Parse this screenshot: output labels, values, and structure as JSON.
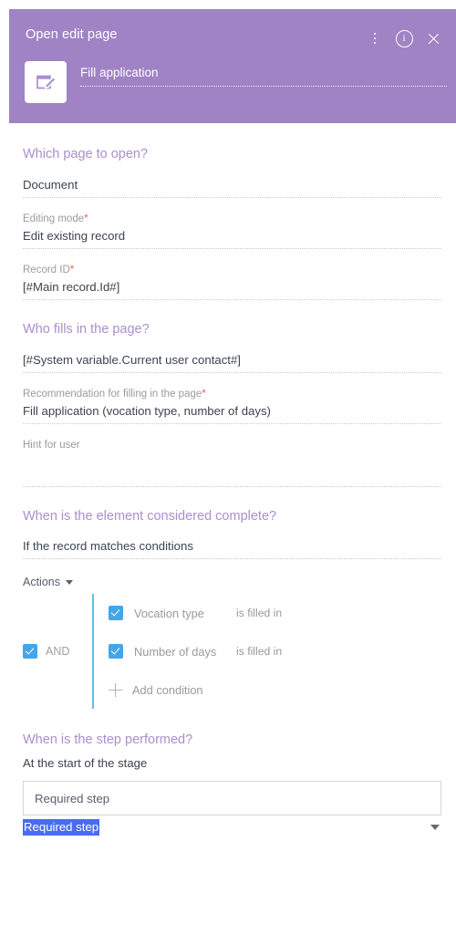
{
  "header": {
    "title": "Open edit page",
    "task_name": "Fill application",
    "icon": "edit-document-icon",
    "menu_icon": "kebab-menu-icon",
    "info_icon": "info-icon",
    "info_glyph": "i",
    "close_icon": "close-icon",
    "background_color": "#9f83c4"
  },
  "sections": {
    "which_page": {
      "heading": "Which page to open?",
      "fields": [
        {
          "label": "",
          "value": "Document",
          "required": false
        },
        {
          "label": "Editing mode",
          "value": "Edit existing record",
          "required": true
        },
        {
          "label": "Record ID",
          "value": "[#Main record.Id#]",
          "required": true
        }
      ]
    },
    "who_fills": {
      "heading": "Who fills in the page?",
      "fields": [
        {
          "label": "",
          "value": "[#System variable.Current user contact#]",
          "required": false
        },
        {
          "label": "Recommendation for filling in the page",
          "value": "Fill application (vocation type, number of days)",
          "required": true
        },
        {
          "label": "Hint for user",
          "value": "",
          "required": false,
          "empty": true
        }
      ]
    },
    "complete": {
      "heading": "When is the element considered complete?",
      "fields": [
        {
          "label": "",
          "value": "If the record matches conditions",
          "required": false
        }
      ],
      "actions_label": "Actions",
      "conditions": {
        "group_operator": "AND",
        "group_checked": true,
        "items": [
          {
            "field": "Vocation type",
            "operator": "is filled in",
            "checked": true
          },
          {
            "field": "Number of days",
            "operator": "is filled in",
            "checked": true
          }
        ],
        "add_label": "Add condition"
      }
    },
    "step_performed": {
      "heading": "When is the step performed?",
      "subtitle": "At the start of the stage",
      "select_value": "Required step",
      "dropdown_selected_value": "Required step"
    }
  },
  "colors": {
    "header_purple": "#9f83c4",
    "section_heading": "#a98fcc",
    "required_asterisk": "#e8604c",
    "checkbox_blue": "#43a6e8",
    "selection_blue": "#4a6cf0"
  }
}
